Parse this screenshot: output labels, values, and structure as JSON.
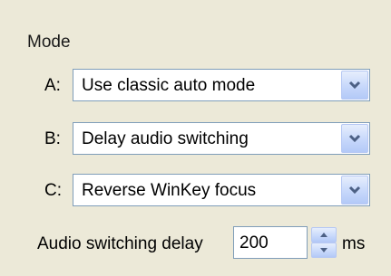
{
  "mode": {
    "title": "Mode",
    "rows": [
      {
        "label": "A:",
        "selected": "Use classic auto mode",
        "icon": "chevron-down-icon"
      },
      {
        "label": "B:",
        "selected": "Delay audio switching",
        "icon": "chevron-down-icon"
      },
      {
        "label": "C:",
        "selected": "Reverse WinKey focus",
        "icon": "chevron-down-icon"
      }
    ]
  },
  "delay": {
    "label": "Audio switching delay",
    "value": "200",
    "unit": "ms",
    "icons": {
      "up": "spin-up-icon",
      "down": "spin-down-icon"
    }
  },
  "colors": {
    "background": "#ece9d8",
    "field_border": "#7f9db9",
    "button_face": "#c7d8fb",
    "arrow": "#4d6185"
  }
}
